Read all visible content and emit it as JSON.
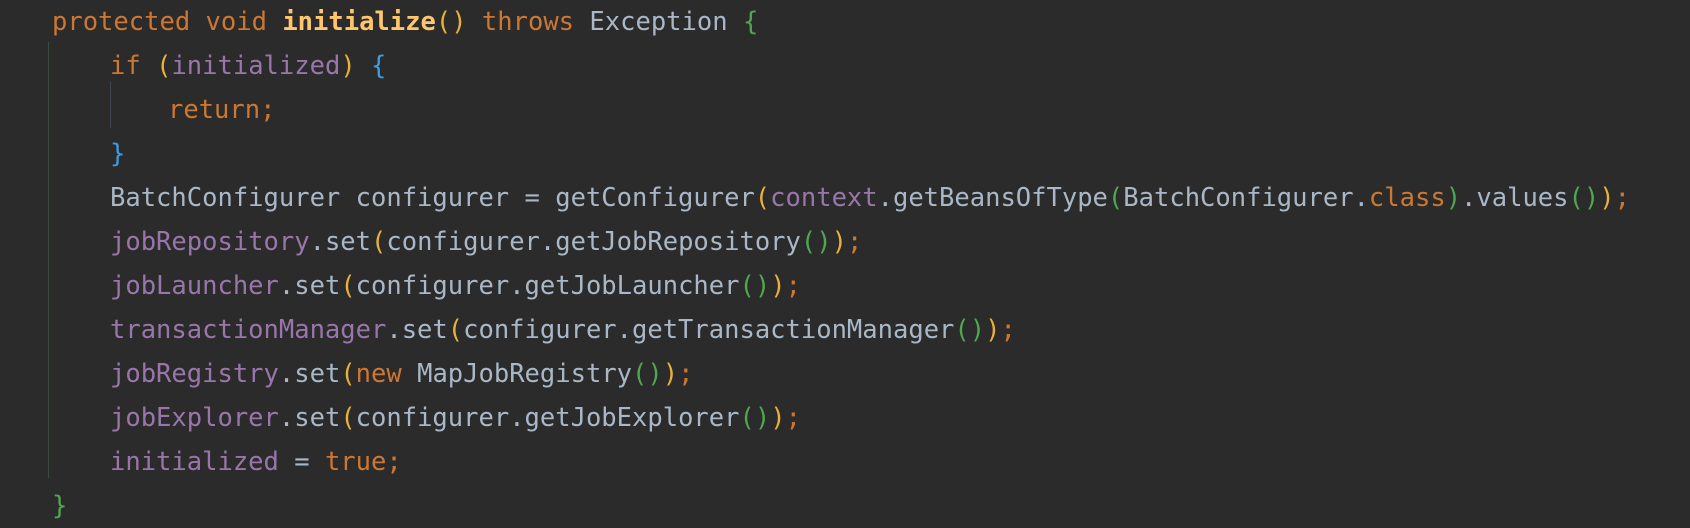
{
  "colors": {
    "background": "#2b2b2b",
    "default": "#a9b7c6",
    "keyword": "#cc7832",
    "method_decl": "#ffc66d",
    "field": "#9876aa",
    "brace_green": "#4fa84f",
    "brace_blue": "#3c9ee0",
    "paren_yellow": "#e8b23a",
    "paren_green": "#4fa84f"
  },
  "lines": [
    {
      "indent": 0,
      "tokens": [
        {
          "text": "protected",
          "t": "kw"
        },
        {
          "text": " ",
          "t": "d"
        },
        {
          "text": "void",
          "t": "kw"
        },
        {
          "text": " ",
          "t": "d"
        },
        {
          "text": "initialize",
          "t": "md"
        },
        {
          "text": "()",
          "t": "py"
        },
        {
          "text": " ",
          "t": "d"
        },
        {
          "text": "throws",
          "t": "kw"
        },
        {
          "text": " ",
          "t": "d"
        },
        {
          "text": "Exception",
          "t": "d"
        },
        {
          "text": " ",
          "t": "d"
        },
        {
          "text": "{",
          "t": "bg"
        }
      ]
    },
    {
      "indent": 1,
      "tokens": [
        {
          "text": "if",
          "t": "kw"
        },
        {
          "text": " ",
          "t": "d"
        },
        {
          "text": "(",
          "t": "py"
        },
        {
          "text": "initialized",
          "t": "f"
        },
        {
          "text": ")",
          "t": "py"
        },
        {
          "text": " ",
          "t": "d"
        },
        {
          "text": "{",
          "t": "bb"
        }
      ]
    },
    {
      "indent": 2,
      "tokens": [
        {
          "text": "return",
          "t": "kw"
        },
        {
          "text": ";",
          "t": "kw"
        }
      ]
    },
    {
      "indent": 1,
      "tokens": [
        {
          "text": "}",
          "t": "bb"
        }
      ]
    },
    {
      "indent": 1,
      "tokens": [
        {
          "text": "BatchConfigurer configurer = getConfigurer",
          "t": "d"
        },
        {
          "text": "(",
          "t": "py"
        },
        {
          "text": "context",
          "t": "f"
        },
        {
          "text": ".getBeansOfType",
          "t": "d"
        },
        {
          "text": "(",
          "t": "pg"
        },
        {
          "text": "BatchConfigurer.",
          "t": "d"
        },
        {
          "text": "class",
          "t": "kw"
        },
        {
          "text": ")",
          "t": "pg"
        },
        {
          "text": ".values",
          "t": "d"
        },
        {
          "text": "()",
          "t": "pg"
        },
        {
          "text": ")",
          "t": "py"
        },
        {
          "text": ";",
          "t": "kw"
        }
      ]
    },
    {
      "indent": 1,
      "tokens": [
        {
          "text": "jobRepository",
          "t": "f"
        },
        {
          "text": ".set",
          "t": "d"
        },
        {
          "text": "(",
          "t": "py"
        },
        {
          "text": "configurer.getJobRepository",
          "t": "d"
        },
        {
          "text": "()",
          "t": "pg"
        },
        {
          "text": ")",
          "t": "py"
        },
        {
          "text": ";",
          "t": "kw"
        }
      ]
    },
    {
      "indent": 1,
      "tokens": [
        {
          "text": "jobLauncher",
          "t": "f"
        },
        {
          "text": ".set",
          "t": "d"
        },
        {
          "text": "(",
          "t": "py"
        },
        {
          "text": "configurer.getJobLauncher",
          "t": "d"
        },
        {
          "text": "()",
          "t": "pg"
        },
        {
          "text": ")",
          "t": "py"
        },
        {
          "text": ";",
          "t": "kw"
        }
      ]
    },
    {
      "indent": 1,
      "tokens": [
        {
          "text": "transactionManager",
          "t": "f"
        },
        {
          "text": ".set",
          "t": "d"
        },
        {
          "text": "(",
          "t": "py"
        },
        {
          "text": "configurer.getTransactionManager",
          "t": "d"
        },
        {
          "text": "()",
          "t": "pg"
        },
        {
          "text": ")",
          "t": "py"
        },
        {
          "text": ";",
          "t": "kw"
        }
      ]
    },
    {
      "indent": 1,
      "tokens": [
        {
          "text": "jobRegistry",
          "t": "f"
        },
        {
          "text": ".set",
          "t": "d"
        },
        {
          "text": "(",
          "t": "py"
        },
        {
          "text": "new",
          "t": "kw"
        },
        {
          "text": " MapJobRegistry",
          "t": "d"
        },
        {
          "text": "()",
          "t": "pg"
        },
        {
          "text": ")",
          "t": "py"
        },
        {
          "text": ";",
          "t": "kw"
        }
      ]
    },
    {
      "indent": 1,
      "tokens": [
        {
          "text": "jobExplorer",
          "t": "f"
        },
        {
          "text": ".set",
          "t": "d"
        },
        {
          "text": "(",
          "t": "py"
        },
        {
          "text": "configurer.getJobExplorer",
          "t": "d"
        },
        {
          "text": "()",
          "t": "pg"
        },
        {
          "text": ")",
          "t": "py"
        },
        {
          "text": ";",
          "t": "kw"
        }
      ]
    },
    {
      "indent": 1,
      "tokens": [
        {
          "text": "initialized",
          "t": "f"
        },
        {
          "text": " = ",
          "t": "d"
        },
        {
          "text": "true",
          "t": "kw"
        },
        {
          "text": ";",
          "t": "kw"
        }
      ]
    },
    {
      "indent": 0,
      "tokens": [
        {
          "text": "}",
          "t": "bg"
        }
      ]
    }
  ]
}
